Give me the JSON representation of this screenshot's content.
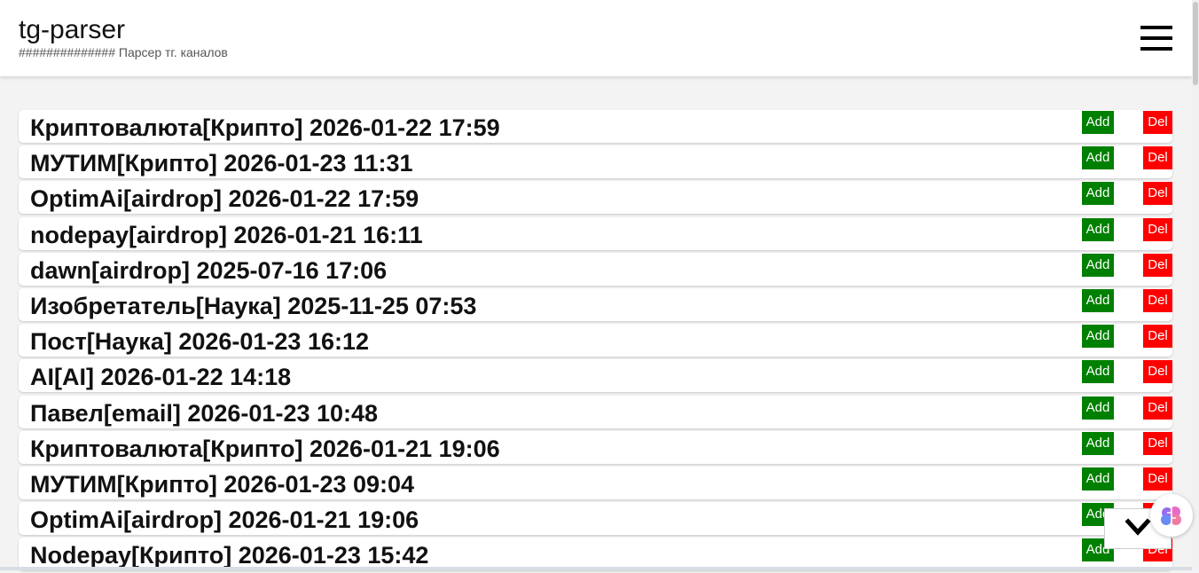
{
  "header": {
    "title": "tg-parser",
    "subtitle": "############## Парсер тг. каналов",
    "menu_icon": "hamburger-menu-icon"
  },
  "colors": {
    "add": "#008000",
    "del": "#ff0000",
    "background": "#f3f3f3"
  },
  "list": {
    "items": [
      {
        "label": "Криптовалюта[Крипто] 2026-01-22 17:59",
        "add": "Add",
        "del": "Del"
      },
      {
        "label": "МУТИМ[Крипто] 2026-01-23 11:31",
        "add": "Add",
        "del": "Del"
      },
      {
        "label": "OptimAi[airdrop] 2026-01-22 17:59",
        "add": "Add",
        "del": "Del"
      },
      {
        "label": "nodepay[airdrop] 2026-01-21 16:11",
        "add": "Add",
        "del": "Del"
      },
      {
        "label": "dawn[airdrop] 2025-07-16 17:06",
        "add": "Add",
        "del": "Del"
      },
      {
        "label": "Изобретатель[Наука] 2025-11-25 07:53",
        "add": "Add",
        "del": "Del"
      },
      {
        "label": "Пост[Наука] 2026-01-23 16:12",
        "add": "Add",
        "del": "Del"
      },
      {
        "label": "AI[AI] 2026-01-22 14:18",
        "add": "Add",
        "del": "Del"
      },
      {
        "label": "Павел[email] 2026-01-23 10:48",
        "add": "Add",
        "del": "Del"
      },
      {
        "label": "Криптовалюта[Крипто] 2026-01-21 19:06",
        "add": "Add",
        "del": "Del"
      },
      {
        "label": "МУТИМ[Крипто] 2026-01-23 09:04",
        "add": "Add",
        "del": "Del"
      },
      {
        "label": "OptimAi[airdrop] 2026-01-21 19:06",
        "add": "Add",
        "del": "Del"
      },
      {
        "label": "Nodepay[Крипто] 2026-01-23 15:42",
        "add": "Add",
        "del": "Del"
      }
    ]
  },
  "widgets": {
    "scroll_down_icon": "chevron-down-icon",
    "assistant_icon": "brain-icon"
  }
}
